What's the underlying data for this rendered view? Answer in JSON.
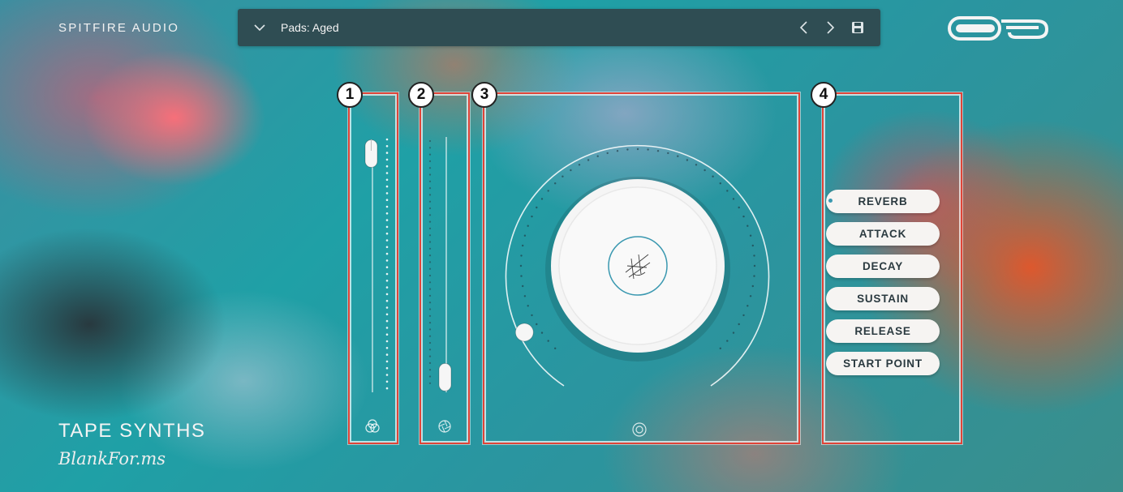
{
  "header": {
    "brand": "SPITFIRE AUDIO",
    "preset_name": "Pads: Aged",
    "icons": [
      "chevron-down-icon",
      "arrow-left-icon",
      "arrow-right-icon",
      "save-icon"
    ]
  },
  "callouts": [
    "1",
    "2",
    "3",
    "4"
  ],
  "right_panel": {
    "items": [
      "REVERB",
      "ATTACK",
      "DECAY",
      "SUSTAIN",
      "RELEASE",
      "START POINT"
    ],
    "selected_index": 0
  },
  "sliders": {
    "slider_1_value": 0.95,
    "slider_2_value": 0.06
  },
  "dial": {
    "value": 0.07
  },
  "footer": {
    "title": "TAPE SYNTHS",
    "subtitle": "BlankFor.ms"
  },
  "colors": {
    "highlight_border": "#e04438",
    "preset_bar": "#2f4d53",
    "accent": "#3a98b0"
  }
}
